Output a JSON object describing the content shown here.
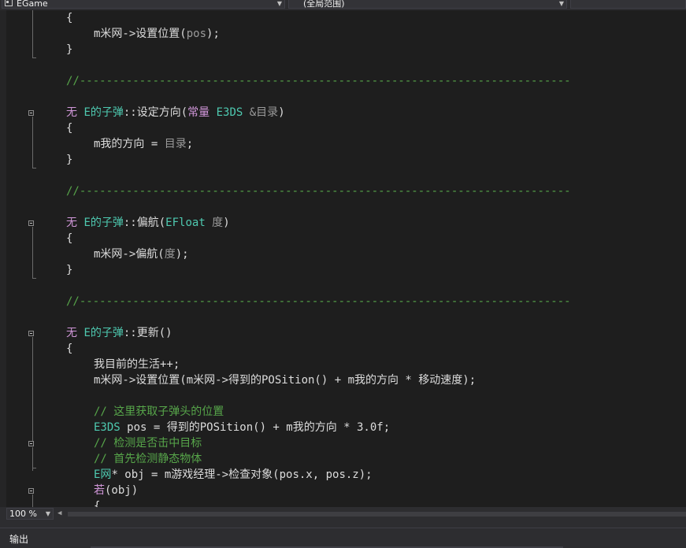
{
  "navbar": {
    "file_combo": "EGame",
    "scope_combo": "(全局范围)"
  },
  "code": {
    "l1": "{",
    "l2": "m米网->设置位置(",
    "l2p": "pos",
    "l2e": ");",
    "l3": "}",
    "sep": "//--------------------------------------------------------------------------",
    "f2_ret": "无",
    "f2_cls": "E的子弹",
    "f2_name": "::设定方向(",
    "f2_kw": "常量",
    "f2_type": "E3DS",
    "f2_param": " &目录",
    "f2_end": ")",
    "f2_open": "{",
    "f2_body": "m我的方向 = ",
    "f2_bodyp": "目录",
    "f2_bodye": ";",
    "f2_close": "}",
    "f3_ret": "无",
    "f3_cls": "E的子弹",
    "f3_name": "::偏航(",
    "f3_type": "EFloat",
    "f3_param": " 度",
    "f3_end": ")",
    "f3_open": "{",
    "f3_body": "m米网->偏航(",
    "f3_bodyp": "度",
    "f3_bodye": ");",
    "f3_close": "}",
    "f4_ret": "无",
    "f4_cls": "E的子弹",
    "f4_name": "::更新()",
    "f4_open": "{",
    "f4_b1": "我目前的生活++;",
    "f4_b2": "m米网->设置位置(m米网->得到的POSition() + m我的方向 * 移动速度);",
    "f4_c1": "// 这里获取子弹头的位置",
    "f4_b3_type": "E3DS",
    "f4_b3": " pos = 得到的POSition() + m我的方向 * 3.0f;",
    "f4_c2": "// 检测是否击中目标",
    "f4_c3": "// 首先检测静态物体",
    "f4_b4_type": "E网",
    "f4_b4": "* obj = m游戏经理->检查对象(pos.x, pos.z);",
    "f4_b5_kw": "若",
    "f4_b5": "(obj)",
    "f4_b6": "{"
  },
  "status": {
    "zoom": "100 %"
  },
  "output": {
    "label": "输出"
  },
  "colors": {
    "background": "#1e1e1e",
    "keyword": "#d197d9",
    "type": "#4ec9b0",
    "comment": "#57a64a",
    "text": "#dcdcdc",
    "param": "#9a9a9a"
  }
}
